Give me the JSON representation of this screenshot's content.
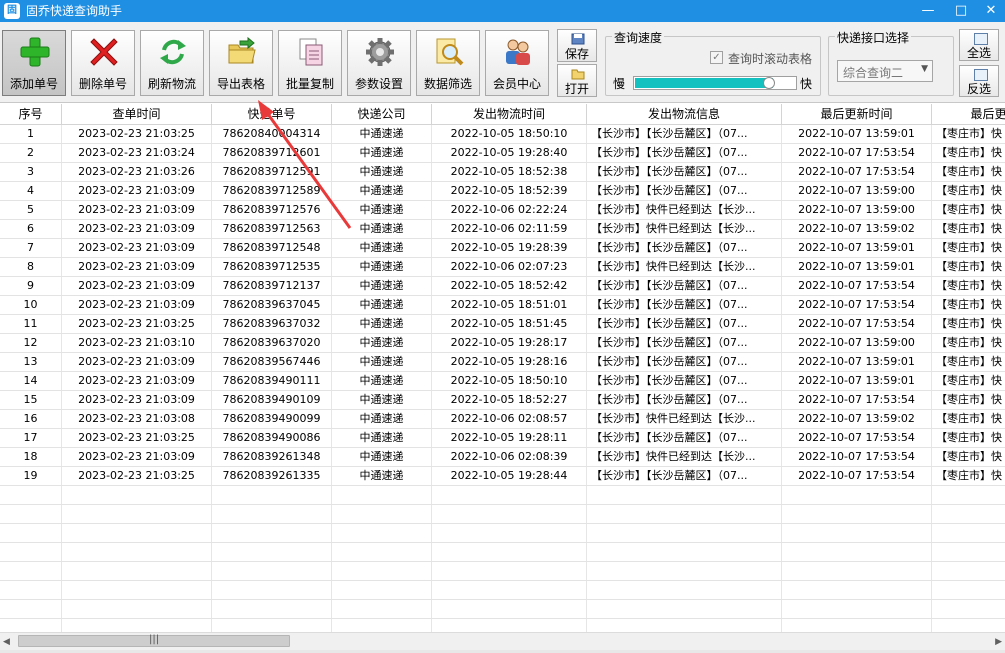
{
  "window": {
    "title": "固乔快递查询助手",
    "app_icon_text": "固",
    "minimize": "—",
    "maximize": "□",
    "close": "✕"
  },
  "toolbar": {
    "buttons": [
      {
        "label": "添加单号",
        "icon": "add-icon"
      },
      {
        "label": "删除单号",
        "icon": "delete-icon"
      },
      {
        "label": "刷新物流",
        "icon": "refresh-icon"
      },
      {
        "label": "导出表格",
        "icon": "export-folder-icon"
      },
      {
        "label": "批量复制",
        "icon": "copy-icon"
      },
      {
        "label": "参数设置",
        "icon": "gear-icon"
      },
      {
        "label": "数据筛选",
        "icon": "filter-search-icon"
      },
      {
        "label": "会员中心",
        "icon": "members-icon"
      }
    ],
    "save_label": "保存",
    "open_label": "打开",
    "speed_group_title": "查询速度",
    "scroll_checkbox_label": "查询时滚动表格",
    "slow_label": "慢",
    "fast_label": "快",
    "speed_value": 0.85,
    "api_group_title": "快递接口选择",
    "api_selected": "综合查询二",
    "select_all_label": "全选",
    "invert_label": "反选"
  },
  "table": {
    "columns": [
      "序号",
      "查单时间",
      "快递单号",
      "快递公司",
      "发出物流时间",
      "发出物流信息",
      "最后更新时间",
      "最后更新物流"
    ],
    "rows": [
      [
        "1",
        "2023-02-23  21:03:25",
        "78620840004314",
        "中通速递",
        "2022-10-05  18:50:10",
        "【长沙市】【长沙岳麓区】（07...",
        "2022-10-07  13:59:01",
        "【枣庄市】快"
      ],
      [
        "2",
        "2023-02-23  21:03:24",
        "78620839712601",
        "中通速递",
        "2022-10-05  19:28:40",
        "【长沙市】【长沙岳麓区】（07...",
        "2022-10-07  17:53:54",
        "【枣庄市】快"
      ],
      [
        "3",
        "2023-02-23  21:03:26",
        "78620839712591",
        "中通速递",
        "2022-10-05  18:52:38",
        "【长沙市】【长沙岳麓区】（07...",
        "2022-10-07  17:53:54",
        "【枣庄市】快"
      ],
      [
        "4",
        "2023-02-23  21:03:09",
        "78620839712589",
        "中通速递",
        "2022-10-05  18:52:39",
        "【长沙市】【长沙岳麓区】（07...",
        "2022-10-07  13:59:00",
        "【枣庄市】快"
      ],
      [
        "5",
        "2023-02-23  21:03:09",
        "78620839712576",
        "中通速递",
        "2022-10-06  02:22:24",
        "【长沙市】快件已经到达【长沙...",
        "2022-10-07  13:59:00",
        "【枣庄市】快"
      ],
      [
        "6",
        "2023-02-23  21:03:09",
        "78620839712563",
        "中通速递",
        "2022-10-06  02:11:59",
        "【长沙市】快件已经到达【长沙...",
        "2022-10-07  13:59:02",
        "【枣庄市】快"
      ],
      [
        "7",
        "2023-02-23  21:03:09",
        "78620839712548",
        "中通速递",
        "2022-10-05  19:28:39",
        "【长沙市】【长沙岳麓区】（07...",
        "2022-10-07  13:59:01",
        "【枣庄市】快"
      ],
      [
        "8",
        "2023-02-23  21:03:09",
        "78620839712535",
        "中通速递",
        "2022-10-06  02:07:23",
        "【长沙市】快件已经到达【长沙...",
        "2022-10-07  13:59:01",
        "【枣庄市】快"
      ],
      [
        "9",
        "2023-02-23  21:03:09",
        "78620839712137",
        "中通速递",
        "2022-10-05  18:52:42",
        "【长沙市】【长沙岳麓区】（07...",
        "2022-10-07  17:53:54",
        "【枣庄市】快"
      ],
      [
        "10",
        "2023-02-23  21:03:09",
        "78620839637045",
        "中通速递",
        "2022-10-05  18:51:01",
        "【长沙市】【长沙岳麓区】（07...",
        "2022-10-07  17:53:54",
        "【枣庄市】快"
      ],
      [
        "11",
        "2023-02-23  21:03:25",
        "78620839637032",
        "中通速递",
        "2022-10-05  18:51:45",
        "【长沙市】【长沙岳麓区】（07...",
        "2022-10-07  17:53:54",
        "【枣庄市】快"
      ],
      [
        "12",
        "2023-02-23  21:03:10",
        "78620839637020",
        "中通速递",
        "2022-10-05  19:28:17",
        "【长沙市】【长沙岳麓区】（07...",
        "2022-10-07  13:59:00",
        "【枣庄市】快"
      ],
      [
        "13",
        "2023-02-23  21:03:09",
        "78620839567446",
        "中通速递",
        "2022-10-05  19:28:16",
        "【长沙市】【长沙岳麓区】（07...",
        "2022-10-07  13:59:01",
        "【枣庄市】快"
      ],
      [
        "14",
        "2023-02-23  21:03:09",
        "78620839490111",
        "中通速递",
        "2022-10-05  18:50:10",
        "【长沙市】【长沙岳麓区】（07...",
        "2022-10-07  13:59:01",
        "【枣庄市】快"
      ],
      [
        "15",
        "2023-02-23  21:03:09",
        "78620839490109",
        "中通速递",
        "2022-10-05  18:52:27",
        "【长沙市】【长沙岳麓区】（07...",
        "2022-10-07  17:53:54",
        "【枣庄市】快"
      ],
      [
        "16",
        "2023-02-23  21:03:08",
        "78620839490099",
        "中通速递",
        "2022-10-06  02:08:57",
        "【长沙市】快件已经到达【长沙...",
        "2022-10-07  13:59:02",
        "【枣庄市】快"
      ],
      [
        "17",
        "2023-02-23  21:03:25",
        "78620839490086",
        "中通速递",
        "2022-10-05  19:28:11",
        "【长沙市】【长沙岳麓区】（07...",
        "2022-10-07  17:53:54",
        "【枣庄市】快"
      ],
      [
        "18",
        "2023-02-23  21:03:09",
        "78620839261348",
        "中通速递",
        "2022-10-06  02:08:39",
        "【长沙市】快件已经到达【长沙...",
        "2022-10-07  17:53:54",
        "【枣庄市】快"
      ],
      [
        "19",
        "2023-02-23  21:03:25",
        "78620839261335",
        "中通速递",
        "2022-10-05  19:28:44",
        "【长沙市】【长沙岳麓区】（07...",
        "2022-10-07  17:53:54",
        "【枣庄市】快"
      ]
    ]
  },
  "scrollbar": {
    "left_arrow": "◀",
    "right_arrow": "▶",
    "grip": "|||"
  },
  "colors": {
    "titlebar": "#1e8fe3",
    "speed_fill": "#14c1c1",
    "annotation_arrow": "#e83a3a"
  }
}
